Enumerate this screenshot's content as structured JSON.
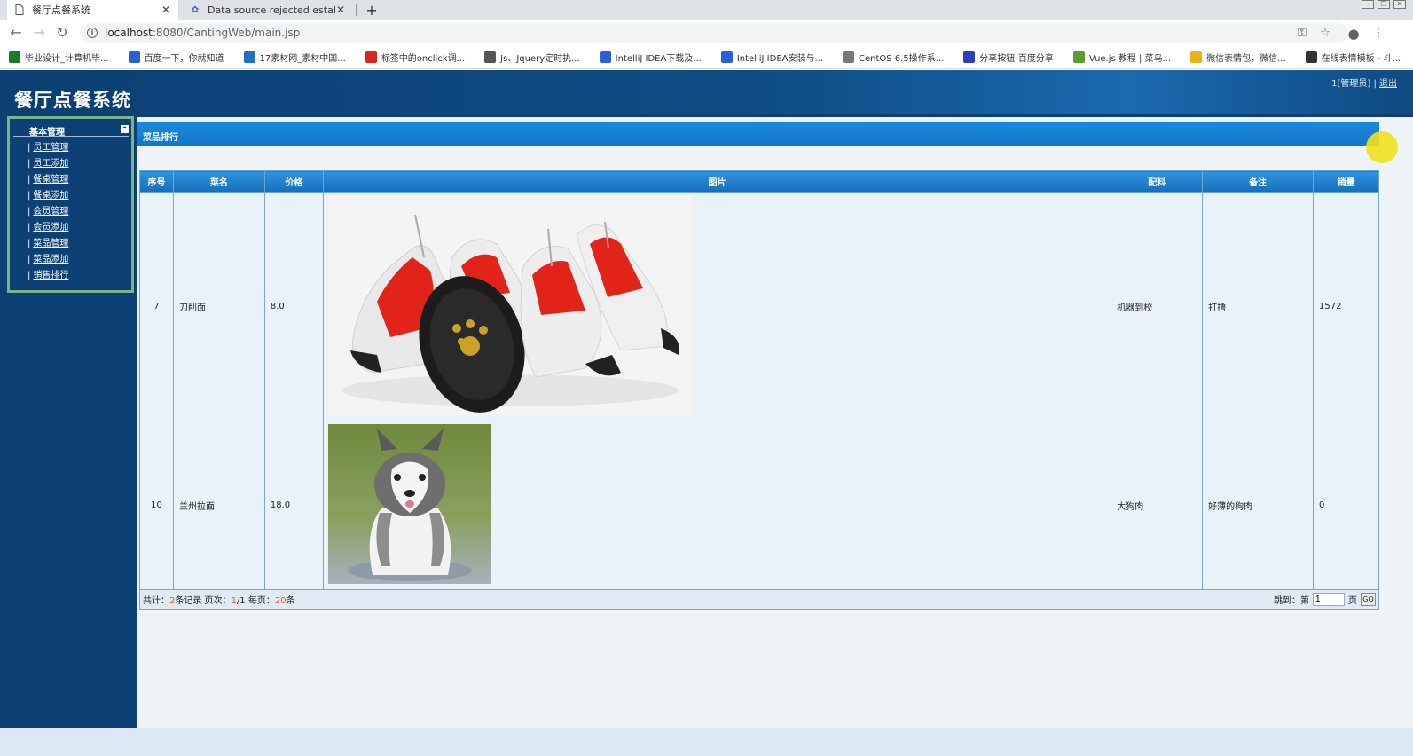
{
  "browser": {
    "tabs": [
      {
        "title": "餐厅点餐系统",
        "active": true
      },
      {
        "title": "Data source rejected establish",
        "active": false
      }
    ],
    "new_tab": "+",
    "url_host": "localhost",
    "url_rest": ":8080/CantingWeb/main.jsp",
    "bookmarks": [
      {
        "label": "毕业设计_计算机毕...",
        "icon": "bookmark-flag-icon",
        "color": "#1a7a2e"
      },
      {
        "label": "百度一下，你就知道",
        "icon": "baidu-paw-icon",
        "color": "#2b5fd9"
      },
      {
        "label": "17素材网_素材中国...",
        "icon": "sucai-icon",
        "color": "#1f6fc4"
      },
      {
        "label": "标签中的onclick调...",
        "icon": "csdn-c-icon",
        "color": "#d9261c"
      },
      {
        "label": "Js、Jquery定时执...",
        "icon": "moon-icon",
        "color": "#555555"
      },
      {
        "label": "IntelliJ IDEA下载及...",
        "icon": "baidu-paw-icon",
        "color": "#2b5fd9"
      },
      {
        "label": "IntelliJ IDEA安装与...",
        "icon": "baidu-paw-icon",
        "color": "#2b5fd9"
      },
      {
        "label": "CentOS 6.5操作系...",
        "icon": "page-icon",
        "color": "#777777"
      },
      {
        "label": "分享按钮-百度分享",
        "icon": "share-icon",
        "color": "#2b3fc0"
      },
      {
        "label": "Vue.js 教程 | 菜鸟...",
        "icon": "runoob-icon",
        "color": "#5a9e2f"
      },
      {
        "label": "微信表情包，微信...",
        "icon": "emoji-icon",
        "color": "#e8b21a"
      },
      {
        "label": "在线表情模板 - 斗...",
        "icon": "template-icon",
        "color": "#333333"
      }
    ]
  },
  "app": {
    "title": "餐厅点餐系统",
    "user": "1[管理员]",
    "separator": "|",
    "logout": "退出",
    "menu_header": "基本管理",
    "collapse_symbol": "-",
    "menu": [
      "员工管理",
      "员工添加",
      "餐桌管理",
      "餐桌添加",
      "会员管理",
      "会员添加",
      "菜品管理",
      "菜品添加",
      "销售排行"
    ],
    "menu_bar": "|"
  },
  "panel": {
    "title": "菜品排行",
    "columns": [
      "序号",
      "菜名",
      "价格",
      "图片",
      "配料",
      "备注",
      "销量"
    ],
    "rows": [
      {
        "id": "7",
        "name": "刀削面",
        "price": "8.0",
        "image": "red-dog-shoes-photo",
        "ingredients": "机器到校",
        "note": "打撸",
        "sales": "1572"
      },
      {
        "id": "10",
        "name": "兰州拉面",
        "price": "18.0",
        "image": "husky-puppy-photo",
        "ingredients": "大狗肉",
        "note": "好薄的狗肉",
        "sales": "0"
      }
    ],
    "pager": {
      "total_prefix": "共计：",
      "total": "2",
      "total_suffix": "条记录 页次：",
      "page": "1",
      "page_sep": "/1 每页：",
      "per_page": "20",
      "per_page_suffix": "条",
      "jump_label": "跳到：第",
      "jump_value": "1",
      "page_label": "页",
      "go": "GO"
    }
  }
}
